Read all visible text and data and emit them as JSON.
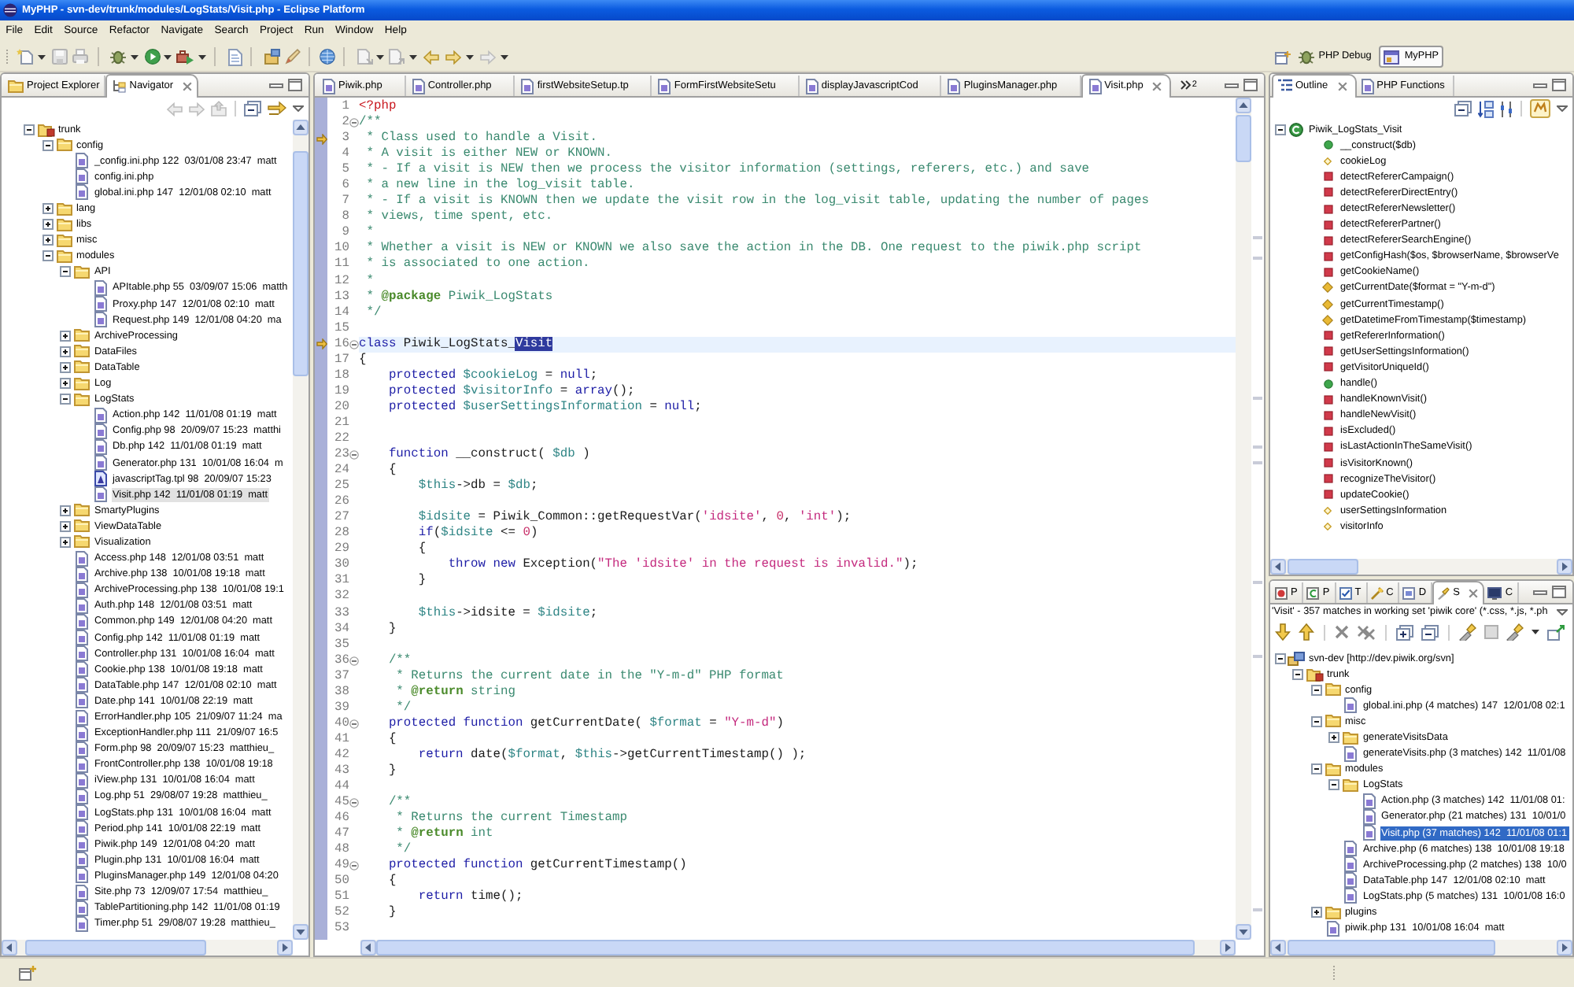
{
  "window": {
    "title": "MyPHP - svn-dev/trunk/modules/LogStats/Visit.php - Eclipse Platform"
  },
  "menu": [
    "File",
    "Edit",
    "Source",
    "Refactor",
    "Navigate",
    "Search",
    "Project",
    "Run",
    "Window",
    "Help"
  ],
  "perspectives": [
    {
      "label": "PHP Debug",
      "selected": false
    },
    {
      "label": "MyPHP",
      "selected": true
    }
  ],
  "navigator": {
    "tabs": [
      {
        "label": "Project Explorer",
        "selected": false
      },
      {
        "label": "Navigator",
        "selected": true
      }
    ],
    "tree": [
      {
        "label": "trunk",
        "kind": "project",
        "expanded": true,
        "selected": false,
        "children": [
          {
            "label": "config",
            "kind": "folder",
            "expanded": true,
            "selected": false,
            "children": [
              {
                "label": "_config.ini.php 122  03/01/08 23:47  matt",
                "kind": "file",
                "selected": false
              },
              {
                "label": "config.ini.php",
                "kind": "file",
                "selected": false
              },
              {
                "label": "global.ini.php 147  12/01/08 02:10  matt",
                "kind": "file",
                "selected": false
              }
            ]
          },
          {
            "label": "lang",
            "kind": "folder",
            "expanded": false,
            "selected": false
          },
          {
            "label": "libs",
            "kind": "folder",
            "expanded": false,
            "selected": false
          },
          {
            "label": "misc",
            "kind": "folder",
            "expanded": false,
            "selected": false
          },
          {
            "label": "modules",
            "kind": "folder",
            "expanded": true,
            "selected": false,
            "children": [
              {
                "label": "API",
                "kind": "folder",
                "expanded": true,
                "selected": false,
                "children": [
                  {
                    "label": "APItable.php 55  03/09/07 15:06  matth",
                    "kind": "file",
                    "selected": false
                  },
                  {
                    "label": "Proxy.php 147  12/01/08 02:10  matt",
                    "kind": "file",
                    "selected": false
                  },
                  {
                    "label": "Request.php 149  12/01/08 04:20  ma",
                    "kind": "file",
                    "selected": false
                  }
                ]
              },
              {
                "label": "ArchiveProcessing",
                "kind": "folder",
                "expanded": false,
                "selected": false
              },
              {
                "label": "DataFiles",
                "kind": "folder",
                "expanded": false,
                "selected": false
              },
              {
                "label": "DataTable",
                "kind": "folder",
                "expanded": false,
                "selected": false
              },
              {
                "label": "Log",
                "kind": "folder",
                "expanded": false,
                "selected": false
              },
              {
                "label": "LogStats",
                "kind": "folder",
                "expanded": true,
                "selected": false,
                "children": [
                  {
                    "label": "Action.php 142  11/01/08 01:19  matt",
                    "kind": "file",
                    "selected": false
                  },
                  {
                    "label": "Config.php 98  20/09/07 15:23  matthi",
                    "kind": "file",
                    "selected": false
                  },
                  {
                    "label": "Db.php 142  11/01/08 01:19  matt",
                    "kind": "file",
                    "selected": false
                  },
                  {
                    "label": "Generator.php 131  10/01/08 16:04  m",
                    "kind": "file",
                    "selected": false
                  },
                  {
                    "label": "javascriptTag.tpl 98  20/09/07 15:23",
                    "kind": "template",
                    "selected": false
                  },
                  {
                    "label": "Visit.php 142  11/01/08 01:19  matt",
                    "kind": "file",
                    "selected": true
                  }
                ]
              },
              {
                "label": "SmartyPlugins",
                "kind": "folder",
                "expanded": false,
                "selected": false
              },
              {
                "label": "ViewDataTable",
                "kind": "folder",
                "expanded": false,
                "selected": false
              },
              {
                "label": "Visualization",
                "kind": "folder",
                "expanded": false,
                "selected": false
              },
              {
                "label": "Access.php 148  12/01/08 03:51  matt",
                "kind": "file",
                "selected": false
              },
              {
                "label": "Archive.php 138  10/01/08 19:18  matt",
                "kind": "file",
                "selected": false
              },
              {
                "label": "ArchiveProcessing.php 138  10/01/08 19:1",
                "kind": "file",
                "selected": false
              },
              {
                "label": "Auth.php 148  12/01/08 03:51  matt",
                "kind": "file",
                "selected": false
              },
              {
                "label": "Common.php 149  12/01/08 04:20  matt",
                "kind": "file",
                "selected": false
              },
              {
                "label": "Config.php 142  11/01/08 01:19  matt",
                "kind": "file",
                "selected": false
              },
              {
                "label": "Controller.php 131  10/01/08 16:04  matt",
                "kind": "file",
                "selected": false
              },
              {
                "label": "Cookie.php 138  10/01/08 19:18  matt",
                "kind": "file",
                "selected": false
              },
              {
                "label": "DataTable.php 147  12/01/08 02:10  matt",
                "kind": "file",
                "selected": false
              },
              {
                "label": "Date.php 141  10/01/08 22:19  matt",
                "kind": "file",
                "selected": false
              },
              {
                "label": "ErrorHandler.php 105  21/09/07 11:24  ma",
                "kind": "file",
                "selected": false
              },
              {
                "label": "ExceptionHandler.php 111  21/09/07 16:5",
                "kind": "file",
                "selected": false
              },
              {
                "label": "Form.php 98  20/09/07 15:23  matthieu_",
                "kind": "file",
                "selected": false
              },
              {
                "label": "FrontController.php 138  10/01/08 19:18",
                "kind": "file",
                "selected": false
              },
              {
                "label": "iView.php 131  10/01/08 16:04  matt",
                "kind": "file",
                "selected": false
              },
              {
                "label": "Log.php 51  29/08/07 19:28  matthieu_",
                "kind": "file",
                "selected": false
              },
              {
                "label": "LogStats.php 131  10/01/08 16:04  matt",
                "kind": "file",
                "selected": false
              },
              {
                "label": "Period.php 141  10/01/08 22:19  matt",
                "kind": "file",
                "selected": false
              },
              {
                "label": "Piwik.php 149  12/01/08 04:20  matt",
                "kind": "file",
                "selected": false
              },
              {
                "label": "Plugin.php 131  10/01/08 16:04  matt",
                "kind": "file",
                "selected": false
              },
              {
                "label": "PluginsManager.php 149  12/01/08 04:20",
                "kind": "file",
                "selected": false
              },
              {
                "label": "Site.php 73  12/09/07 17:54  matthieu_",
                "kind": "file",
                "selected": false
              },
              {
                "label": "TablePartitioning.php 142  11/01/08 01:19",
                "kind": "file",
                "selected": false
              },
              {
                "label": "Timer.php 51  29/08/07 19:28  matthieu_",
                "kind": "file",
                "selected": false
              }
            ]
          }
        ]
      }
    ]
  },
  "editor": {
    "tabs": [
      {
        "label": "Piwik.php",
        "selected": false
      },
      {
        "label": "Controller.php",
        "selected": false
      },
      {
        "label": "firstWebsiteSetup.tp",
        "selected": false
      },
      {
        "label": "FormFirstWebsiteSetu",
        "selected": false
      },
      {
        "label": "displayJavascriptCod",
        "selected": false
      },
      {
        "label": "PluginsManager.php",
        "selected": false
      },
      {
        "label": "Visit.php",
        "selected": true
      }
    ],
    "overflow_count": "2",
    "lines": [
      {
        "number": "1",
        "fold": false,
        "marker": false,
        "current": false,
        "tokens": [
          {
            "kind": "tag",
            "text": "<?php"
          }
        ]
      },
      {
        "number": "2",
        "fold": true,
        "marker": false,
        "current": false,
        "tokens": [
          {
            "kind": "comment",
            "text": "/**"
          }
        ]
      },
      {
        "number": "3",
        "fold": false,
        "marker": true,
        "current": false,
        "tokens": [
          {
            "kind": "comment",
            "text": " * Class used to handle a Visit."
          }
        ]
      },
      {
        "number": "4",
        "fold": false,
        "marker": false,
        "current": false,
        "tokens": [
          {
            "kind": "comment",
            "text": " * A visit is either NEW or KNOWN."
          }
        ]
      },
      {
        "number": "5",
        "fold": false,
        "marker": false,
        "current": false,
        "tokens": [
          {
            "kind": "comment",
            "text": " * - If a visit is NEW then we process the visitor information (settings, referers, etc.) and save"
          }
        ]
      },
      {
        "number": "6",
        "fold": false,
        "marker": false,
        "current": false,
        "tokens": [
          {
            "kind": "comment",
            "text": " * a new line in the log_visit table."
          }
        ]
      },
      {
        "number": "7",
        "fold": false,
        "marker": false,
        "current": false,
        "tokens": [
          {
            "kind": "comment",
            "text": " * - If a visit is KNOWN then we update the visit row in the log_visit table, updating the number of pages"
          }
        ]
      },
      {
        "number": "8",
        "fold": false,
        "marker": false,
        "current": false,
        "tokens": [
          {
            "kind": "comment",
            "text": " * views, time spent, etc."
          }
        ]
      },
      {
        "number": "9",
        "fold": false,
        "marker": false,
        "current": false,
        "tokens": [
          {
            "kind": "comment",
            "text": " *"
          }
        ]
      },
      {
        "number": "10",
        "fold": false,
        "marker": false,
        "current": false,
        "tokens": [
          {
            "kind": "comment",
            "text": " * Whether a visit is NEW or KNOWN we also save the action in the DB. One request to the piwik.php script"
          }
        ]
      },
      {
        "number": "11",
        "fold": false,
        "marker": false,
        "current": false,
        "tokens": [
          {
            "kind": "comment",
            "text": " * is associated to one action."
          }
        ]
      },
      {
        "number": "12",
        "fold": false,
        "marker": false,
        "current": false,
        "tokens": [
          {
            "kind": "comment",
            "text": " *"
          }
        ]
      },
      {
        "number": "13",
        "fold": false,
        "marker": false,
        "current": false,
        "tokens": [
          {
            "kind": "comment",
            "text": " * "
          },
          {
            "kind": "doctag",
            "text": "@package"
          },
          {
            "kind": "comment",
            "text": " Piwik_LogStats"
          }
        ]
      },
      {
        "number": "14",
        "fold": false,
        "marker": false,
        "current": false,
        "tokens": [
          {
            "kind": "comment",
            "text": " */"
          }
        ]
      },
      {
        "number": "15",
        "fold": false,
        "marker": false,
        "current": false
      },
      {
        "number": "16",
        "fold": true,
        "marker": true,
        "current": true,
        "tokens": [
          {
            "kind": "keyword",
            "text": "class"
          },
          {
            "kind": "plain",
            "text": " Piwik_LogStats_"
          },
          {
            "kind": "selection",
            "text": "Visit"
          }
        ]
      },
      {
        "number": "17",
        "fold": false,
        "marker": false,
        "current": false,
        "tokens": [
          {
            "kind": "plain",
            "text": "{"
          }
        ]
      },
      {
        "number": "18",
        "fold": false,
        "marker": false,
        "current": false,
        "tokens": [
          {
            "kind": "keyword",
            "text": "    protected"
          },
          {
            "kind": "variable",
            "text": " $cookieLog"
          },
          {
            "kind": "plain",
            "text": " = "
          },
          {
            "kind": "keyword",
            "text": "null"
          },
          {
            "kind": "plain",
            "text": ";"
          }
        ]
      },
      {
        "number": "19",
        "fold": false,
        "marker": false,
        "current": false,
        "tokens": [
          {
            "kind": "keyword",
            "text": "    protected"
          },
          {
            "kind": "variable",
            "text": " $visitorInfo"
          },
          {
            "kind": "plain",
            "text": " = "
          },
          {
            "kind": "keyword",
            "text": "array"
          },
          {
            "kind": "plain",
            "text": "();"
          }
        ]
      },
      {
        "number": "20",
        "fold": false,
        "marker": false,
        "current": false,
        "tokens": [
          {
            "kind": "keyword",
            "text": "    protected"
          },
          {
            "kind": "variable",
            "text": " $userSettingsInformation"
          },
          {
            "kind": "plain",
            "text": " = "
          },
          {
            "kind": "keyword",
            "text": "null"
          },
          {
            "kind": "plain",
            "text": ";"
          }
        ]
      },
      {
        "number": "21",
        "fold": false,
        "marker": false,
        "current": false
      },
      {
        "number": "22",
        "fold": false,
        "marker": false,
        "current": false
      },
      {
        "number": "23",
        "fold": true,
        "marker": false,
        "current": false,
        "tokens": [
          {
            "kind": "keyword",
            "text": "    function"
          },
          {
            "kind": "plain",
            "text": " __construct( "
          },
          {
            "kind": "variable",
            "text": "$db"
          },
          {
            "kind": "plain",
            "text": " )"
          }
        ]
      },
      {
        "number": "24",
        "fold": false,
        "marker": false,
        "current": false,
        "tokens": [
          {
            "kind": "plain",
            "text": "    {"
          }
        ]
      },
      {
        "number": "25",
        "fold": false,
        "marker": false,
        "current": false,
        "tokens": [
          {
            "kind": "variable",
            "text": "        $this"
          },
          {
            "kind": "plain",
            "text": "->db = "
          },
          {
            "kind": "variable",
            "text": "$db"
          },
          {
            "kind": "plain",
            "text": ";"
          }
        ]
      },
      {
        "number": "26",
        "fold": false,
        "marker": false,
        "current": false
      },
      {
        "number": "27",
        "fold": false,
        "marker": false,
        "current": false,
        "tokens": [
          {
            "kind": "variable",
            "text": "        $idsite"
          },
          {
            "kind": "plain",
            "text": " = Piwik_Common::getRequestVar("
          },
          {
            "kind": "string",
            "text": "'idsite'"
          },
          {
            "kind": "plain",
            "text": ", "
          },
          {
            "kind": "number",
            "text": "0"
          },
          {
            "kind": "plain",
            "text": ", "
          },
          {
            "kind": "string",
            "text": "'int'"
          },
          {
            "kind": "plain",
            "text": ");"
          }
        ]
      },
      {
        "number": "28",
        "fold": false,
        "marker": false,
        "current": false,
        "tokens": [
          {
            "kind": "keyword",
            "text": "        if"
          },
          {
            "kind": "plain",
            "text": "("
          },
          {
            "kind": "variable",
            "text": "$idsite"
          },
          {
            "kind": "plain",
            "text": " <= "
          },
          {
            "kind": "number",
            "text": "0"
          },
          {
            "kind": "plain",
            "text": ")"
          }
        ]
      },
      {
        "number": "29",
        "fold": false,
        "marker": false,
        "current": false,
        "tokens": [
          {
            "kind": "plain",
            "text": "        {"
          }
        ]
      },
      {
        "number": "30",
        "fold": false,
        "marker": false,
        "current": false,
        "tokens": [
          {
            "kind": "keyword",
            "text": "            throw"
          },
          {
            "kind": "keyword",
            "text": " new"
          },
          {
            "kind": "plain",
            "text": " Exception("
          },
          {
            "kind": "string",
            "text": "\"The 'idsite' in the request is invalid.\""
          },
          {
            "kind": "plain",
            "text": ");"
          }
        ]
      },
      {
        "number": "31",
        "fold": false,
        "marker": false,
        "current": false,
        "tokens": [
          {
            "kind": "plain",
            "text": "        }"
          }
        ]
      },
      {
        "number": "32",
        "fold": false,
        "marker": false,
        "current": false
      },
      {
        "number": "33",
        "fold": false,
        "marker": false,
        "current": false,
        "tokens": [
          {
            "kind": "variable",
            "text": "        $this"
          },
          {
            "kind": "plain",
            "text": "->idsite = "
          },
          {
            "kind": "variable",
            "text": "$idsite"
          },
          {
            "kind": "plain",
            "text": ";"
          }
        ]
      },
      {
        "number": "34",
        "fold": false,
        "marker": false,
        "current": false,
        "tokens": [
          {
            "kind": "plain",
            "text": "    }"
          }
        ]
      },
      {
        "number": "35",
        "fold": false,
        "marker": false,
        "current": false
      },
      {
        "number": "36",
        "fold": true,
        "marker": false,
        "current": false,
        "tokens": [
          {
            "kind": "comment",
            "text": "    /**"
          }
        ]
      },
      {
        "number": "37",
        "fold": false,
        "marker": false,
        "current": false,
        "tokens": [
          {
            "kind": "comment",
            "text": "     * Returns the current date in the \"Y-m-d\" PHP format"
          }
        ]
      },
      {
        "number": "38",
        "fold": false,
        "marker": false,
        "current": false,
        "tokens": [
          {
            "kind": "comment",
            "text": "     * "
          },
          {
            "kind": "doctag",
            "text": "@return"
          },
          {
            "kind": "comment",
            "text": " string"
          }
        ]
      },
      {
        "number": "39",
        "fold": false,
        "marker": false,
        "current": false,
        "tokens": [
          {
            "kind": "comment",
            "text": "     */"
          }
        ]
      },
      {
        "number": "40",
        "fold": true,
        "marker": false,
        "current": false,
        "tokens": [
          {
            "kind": "keyword",
            "text": "    protected"
          },
          {
            "kind": "keyword",
            "text": " function"
          },
          {
            "kind": "plain",
            "text": " getCurrentDate( "
          },
          {
            "kind": "variable",
            "text": "$format"
          },
          {
            "kind": "plain",
            "text": " = "
          },
          {
            "kind": "string",
            "text": "\"Y-m-d\""
          },
          {
            "kind": "plain",
            "text": ")"
          }
        ]
      },
      {
        "number": "41",
        "fold": false,
        "marker": false,
        "current": false,
        "tokens": [
          {
            "kind": "plain",
            "text": "    {"
          }
        ]
      },
      {
        "number": "42",
        "fold": false,
        "marker": false,
        "current": false,
        "tokens": [
          {
            "kind": "keyword",
            "text": "        return"
          },
          {
            "kind": "plain",
            "text": " date("
          },
          {
            "kind": "variable",
            "text": "$format"
          },
          {
            "kind": "plain",
            "text": ", "
          },
          {
            "kind": "variable",
            "text": "$this"
          },
          {
            "kind": "plain",
            "text": "->getCurrentTimestamp() );"
          }
        ]
      },
      {
        "number": "43",
        "fold": false,
        "marker": false,
        "current": false,
        "tokens": [
          {
            "kind": "plain",
            "text": "    }"
          }
        ]
      },
      {
        "number": "44",
        "fold": false,
        "marker": false,
        "current": false
      },
      {
        "number": "45",
        "fold": true,
        "marker": false,
        "current": false,
        "tokens": [
          {
            "kind": "comment",
            "text": "    /**"
          }
        ]
      },
      {
        "number": "46",
        "fold": false,
        "marker": false,
        "current": false,
        "tokens": [
          {
            "kind": "comment",
            "text": "     * Returns the current Timestamp"
          }
        ]
      },
      {
        "number": "47",
        "fold": false,
        "marker": false,
        "current": false,
        "tokens": [
          {
            "kind": "comment",
            "text": "     * "
          },
          {
            "kind": "doctag",
            "text": "@return"
          },
          {
            "kind": "comment",
            "text": " int"
          }
        ]
      },
      {
        "number": "48",
        "fold": false,
        "marker": false,
        "current": false,
        "tokens": [
          {
            "kind": "comment",
            "text": "     */"
          }
        ]
      },
      {
        "number": "49",
        "fold": true,
        "marker": false,
        "current": false,
        "tokens": [
          {
            "kind": "keyword",
            "text": "    protected"
          },
          {
            "kind": "keyword",
            "text": " function"
          },
          {
            "kind": "plain",
            "text": " getCurrentTimestamp()"
          }
        ]
      },
      {
        "number": "50",
        "fold": false,
        "marker": false,
        "current": false,
        "tokens": [
          {
            "kind": "plain",
            "text": "    {"
          }
        ]
      },
      {
        "number": "51",
        "fold": false,
        "marker": false,
        "current": false,
        "tokens": [
          {
            "kind": "keyword",
            "text": "        return"
          },
          {
            "kind": "plain",
            "text": " time();"
          }
        ]
      },
      {
        "number": "52",
        "fold": false,
        "marker": false,
        "current": false,
        "tokens": [
          {
            "kind": "plain",
            "text": "    }"
          }
        ]
      },
      {
        "number": "53",
        "fold": false,
        "marker": false,
        "current": false
      }
    ]
  },
  "outline": {
    "tabs": [
      {
        "label": "Outline",
        "selected": true
      },
      {
        "label": "PHP Functions",
        "selected": false
      }
    ],
    "tree": [
      {
        "label": "Piwik_LogStats_Visit",
        "kind": "class",
        "expanded": true,
        "selected": false,
        "children": [
          {
            "label": "__construct($db)",
            "kind": "public-method",
            "selected": false
          },
          {
            "label": "cookieLog",
            "kind": "field",
            "selected": false
          },
          {
            "label": "detectRefererCampaign()",
            "kind": "private-method",
            "selected": false
          },
          {
            "label": "detectRefererDirectEntry()",
            "kind": "private-method",
            "selected": false
          },
          {
            "label": "detectRefererNewsletter()",
            "kind": "private-method",
            "selected": false
          },
          {
            "label": "detectRefererPartner()",
            "kind": "private-method",
            "selected": false
          },
          {
            "label": "detectRefererSearchEngine()",
            "kind": "private-method",
            "selected": false
          },
          {
            "label": "getConfigHash($os, $browserName, $browserVe",
            "kind": "private-method",
            "selected": false
          },
          {
            "label": "getCookieName()",
            "kind": "private-method",
            "selected": false
          },
          {
            "label": "getCurrentDate($format = \"Y-m-d\")",
            "kind": "protected-method",
            "selected": false
          },
          {
            "label": "getCurrentTimestamp()",
            "kind": "protected-method",
            "selected": false
          },
          {
            "label": "getDatetimeFromTimestamp($timestamp)",
            "kind": "protected-method",
            "selected": false
          },
          {
            "label": "getRefererInformation()",
            "kind": "private-method",
            "selected": false
          },
          {
            "label": "getUserSettingsInformation()",
            "kind": "private-method",
            "selected": false
          },
          {
            "label": "getVisitorUniqueId()",
            "kind": "private-method",
            "selected": false
          },
          {
            "label": "handle()",
            "kind": "public-method",
            "selected": false
          },
          {
            "label": "handleKnownVisit()",
            "kind": "private-method",
            "selected": false
          },
          {
            "label": "handleNewVisit()",
            "kind": "private-method",
            "selected": false
          },
          {
            "label": "isExcluded()",
            "kind": "private-method",
            "selected": false
          },
          {
            "label": "isLastActionInTheSameVisit()",
            "kind": "private-method",
            "selected": false
          },
          {
            "label": "isVisitorKnown()",
            "kind": "private-method",
            "selected": false
          },
          {
            "label": "recognizeTheVisitor()",
            "kind": "private-method",
            "selected": false
          },
          {
            "label": "updateCookie()",
            "kind": "private-method",
            "selected": false
          },
          {
            "label": "userSettingsInformation",
            "kind": "field",
            "selected": false
          },
          {
            "label": "visitorInfo",
            "kind": "field",
            "selected": false
          }
        ]
      }
    ]
  },
  "search": {
    "tabs": [
      {
        "label": "P",
        "selected": false
      },
      {
        "label": "P",
        "selected": false
      },
      {
        "label": "T",
        "selected": false
      },
      {
        "label": "C",
        "selected": false
      },
      {
        "label": "D",
        "selected": false
      },
      {
        "label": "S",
        "selected": true
      },
      {
        "label": "C",
        "selected": false
      }
    ],
    "summary": "'Visit' - 357 matches in working set 'piwik core' (*.css, *.js, *.ph",
    "tree": [
      {
        "label": "svn-dev [http://dev.piwik.org/svn]",
        "kind": "repository",
        "expanded": true,
        "selected": false,
        "children": [
          {
            "label": "trunk",
            "kind": "project",
            "expanded": true,
            "selected": false,
            "children": [
              {
                "label": "config",
                "kind": "folder",
                "expanded": true,
                "selected": false,
                "children": [
                  {
                    "label": "global.ini.php (4 matches) 147  12/01/08 02:1",
                    "kind": "file",
                    "selected": false
                  }
                ]
              },
              {
                "label": "misc",
                "kind": "folder",
                "expanded": true,
                "selected": false,
                "children": [
                  {
                    "label": "generateVisitsData",
                    "kind": "folder",
                    "expanded": false,
                    "selected": false
                  },
                  {
                    "label": "generateVisits.php (3 matches) 142  11/01/08",
                    "kind": "file",
                    "selected": false
                  }
                ]
              },
              {
                "label": "modules",
                "kind": "folder",
                "expanded": true,
                "selected": false,
                "children": [
                  {
                    "label": "LogStats",
                    "kind": "folder",
                    "expanded": true,
                    "selected": false,
                    "children": [
                      {
                        "label": "Action.php (3 matches) 142  11/01/08 01:",
                        "kind": "file",
                        "selected": false
                      },
                      {
                        "label": "Generator.php (21 matches) 131  10/01/0",
                        "kind": "file",
                        "selected": false
                      },
                      {
                        "label": "Visit.php (37 matches) 142  11/01/08 01:1",
                        "kind": "file",
                        "selected": true
                      }
                    ]
                  },
                  {
                    "label": "Archive.php (6 matches) 138  10/01/08 19:18",
                    "kind": "file",
                    "selected": false
                  },
                  {
                    "label": "ArchiveProcessing.php (2 matches) 138  10/0",
                    "kind": "file",
                    "selected": false
                  },
                  {
                    "label": "DataTable.php 147  12/01/08 02:10  matt",
                    "kind": "file",
                    "selected": false
                  },
                  {
                    "label": "LogStats.php (5 matches) 131  10/01/08 16:0",
                    "kind": "file",
                    "selected": false
                  }
                ]
              },
              {
                "label": "plugins",
                "kind": "folder",
                "expanded": false,
                "selected": false
              },
              {
                "label": "piwik.php 131  10/01/08 16:04  matt",
                "kind": "file",
                "selected": false
              }
            ]
          }
        ]
      }
    ]
  }
}
